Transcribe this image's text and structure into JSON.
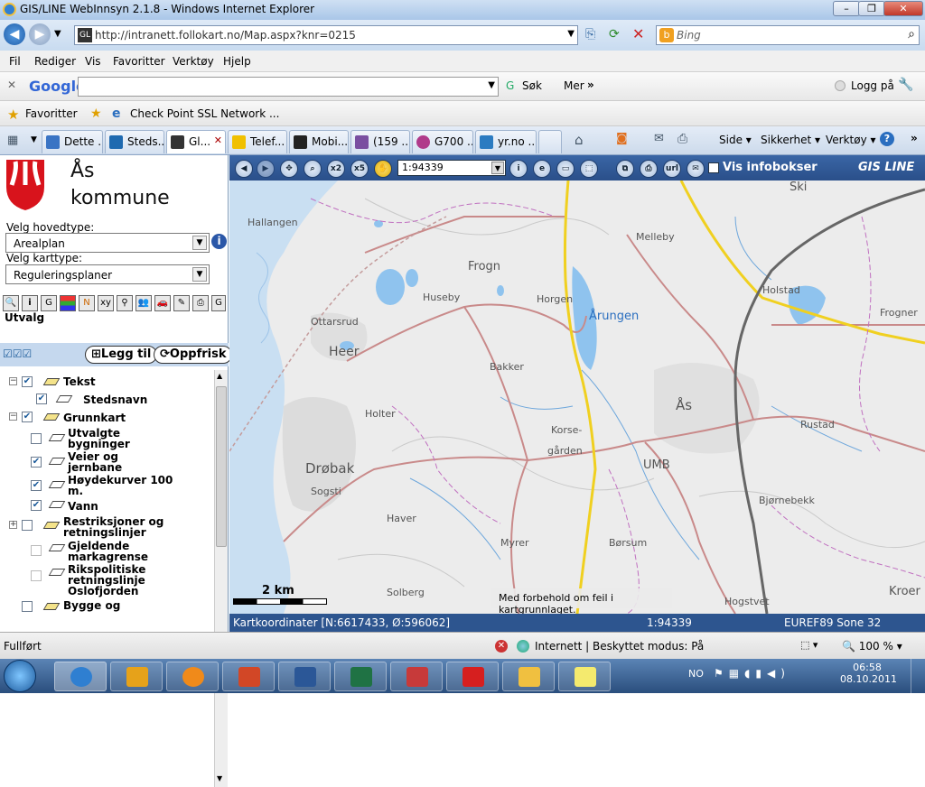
{
  "window": {
    "title": "GIS/LINE WebInnsyn 2.1.8 - Windows Internet Explorer"
  },
  "address": {
    "url": "http://intranett.follokart.no/Map.aspx?knr=0215",
    "search_placeholder": "Bing"
  },
  "menu": [
    "Fil",
    "Rediger",
    "Vis",
    "Favoritter",
    "Verktøy",
    "Hjelp"
  ],
  "google_toolbar": {
    "logo": "Google",
    "search_label": "Søk",
    "more_label": "Mer",
    "login_label": "Logg på"
  },
  "favorites": {
    "label": "Favoritter",
    "link": "Check Point SSL Network ..."
  },
  "tabs": [
    {
      "label": "Dette ...",
      "color": "#3a74c4"
    },
    {
      "label": "Steds...",
      "color": "#1f6ab0"
    },
    {
      "label": "Gl...",
      "color": "#333333",
      "active": true
    },
    {
      "label": "Telef...",
      "color": "#f0c000"
    },
    {
      "label": "Mobi...",
      "color": "#222222"
    },
    {
      "label": "(159 ...",
      "color": "#7a4fa0"
    },
    {
      "label": "G700 ...",
      "color": "#b03a8a"
    },
    {
      "label": "yr.no ...",
      "color": "#2b7bc1"
    }
  ],
  "commands": [
    "Side",
    "Sikkerhet",
    "Verktøy"
  ],
  "panel": {
    "municipality": "Ås kommune",
    "hovedtype_label": "Velg hovedtype:",
    "hovedtype_value": "Arealplan",
    "karttype_label": "Velg karttype:",
    "karttype_value": "Reguleringsplaner",
    "utvalg": "Utvalg",
    "legg_til": "Legg til",
    "oppfrisk": "Oppfrisk"
  },
  "layers": {
    "tekst": "Tekst",
    "stedsnavn": "Stedsnavn",
    "grunnkart": "Grunnkart",
    "utvalgte1": "Utvalgte",
    "utvalgte2": "bygninger",
    "veier1": "Veier og",
    "veier2": "jernbane",
    "hoyde1": "Høydekurver 100",
    "hoyde2": "m.",
    "vann": "Vann",
    "restr1": "Restriksjoner og",
    "restr2": "retningslinjer",
    "gjeld1": "Gjeldende",
    "gjeld2": "markagrense",
    "riks1": "Rikspolitiske",
    "riks2": "retningslinje",
    "riks3": "Oslofjorden",
    "bygge": "Bygge og"
  },
  "map_toolbar": {
    "scale": "1:94339",
    "infobokser": "Vis infobokser",
    "brand": "GIS LINE"
  },
  "map_labels": [
    "Hallangen",
    "Frogn",
    "Melleby",
    "Holstad",
    "Frogner",
    "Huseby",
    "Horgen",
    "Årungen",
    "Ottarsrud",
    "Heer",
    "Bakker",
    "Ås",
    "Holter",
    "Korse-",
    "gården",
    "Rustad",
    "UMB",
    "Drøbak",
    "Sogsti",
    "Bjørnebekk",
    "Haver",
    "Myrer",
    "Børsum",
    "Solberg",
    "Hogstvet",
    "Kroer",
    "Ski"
  ],
  "map_footer": {
    "scale_label": "2 km",
    "disclaimer": "Med forbehold om feil i kartgrunnlaget."
  },
  "map_status": {
    "coords": "Kartkoordinater [N:6617433, Ø:596062]",
    "scale": "1:94339",
    "crs": "EUREF89 Sone 32"
  },
  "ie_status": {
    "left": "Fullført",
    "zone": "Internett | Beskyttet modus: På",
    "zoom": "100 %"
  },
  "taskbar": {
    "lang": "NO",
    "time": "06:58",
    "date": "08.10.2011"
  }
}
